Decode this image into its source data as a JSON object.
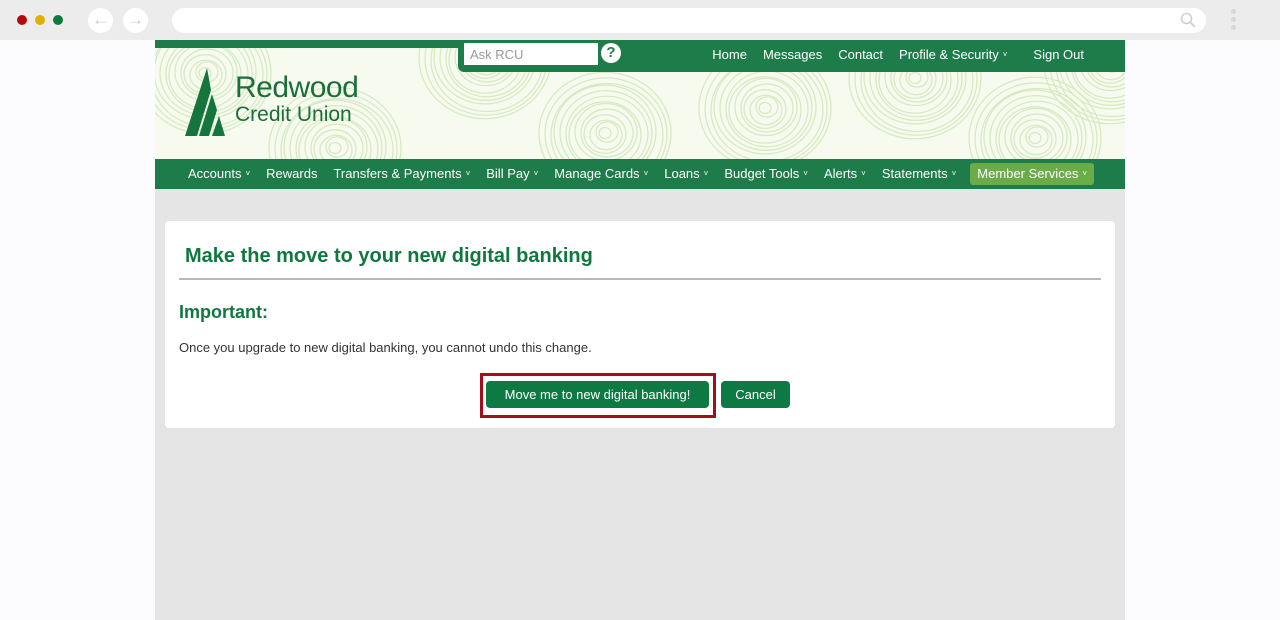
{
  "browser": {
    "back_glyph": "←",
    "forward_glyph": "→",
    "url": "",
    "icons": [
      "close-dot",
      "minimize-dot",
      "maximize-dot",
      "back-arrow-icon",
      "forward-arrow-icon",
      "search-icon",
      "kebab-menu-icon"
    ]
  },
  "colors": {
    "brand_green": "#1d7c4a",
    "heading_green": "#10773f",
    "button_green": "#0e7a43",
    "highlight_nav": "#6aac48",
    "focus_box": "#a20f18",
    "page_bg": "#e5e5e5"
  },
  "header": {
    "logo_line1": "Redwood",
    "logo_line2": "Credit Union",
    "ask_placeholder": "Ask RCU",
    "help_glyph": "?",
    "utility_links": [
      {
        "label": "Home",
        "dropdown": false
      },
      {
        "label": "Messages",
        "dropdown": false
      },
      {
        "label": "Contact",
        "dropdown": false
      },
      {
        "label": "Profile & Security",
        "dropdown": true
      },
      {
        "label": "Sign Out",
        "dropdown": false
      }
    ]
  },
  "nav": {
    "chevron": "⌄",
    "items": [
      {
        "label": "Accounts",
        "dropdown": true
      },
      {
        "label": "Rewards",
        "dropdown": false
      },
      {
        "label": "Transfers & Payments",
        "dropdown": true
      },
      {
        "label": "Bill Pay",
        "dropdown": true
      },
      {
        "label": "Manage Cards",
        "dropdown": true
      },
      {
        "label": "Loans",
        "dropdown": true
      },
      {
        "label": "Budget Tools",
        "dropdown": true
      },
      {
        "label": "Alerts",
        "dropdown": true
      },
      {
        "label": "Statements",
        "dropdown": true
      },
      {
        "label": "Member Services",
        "dropdown": true,
        "highlighted": true
      }
    ]
  },
  "main": {
    "title": "Make the move to your new digital banking",
    "important_label": "Important:",
    "notice": "Once you upgrade to new digital banking, you cannot undo this change.",
    "primary_button": "Move me to new digital banking!",
    "cancel_button": "Cancel"
  }
}
